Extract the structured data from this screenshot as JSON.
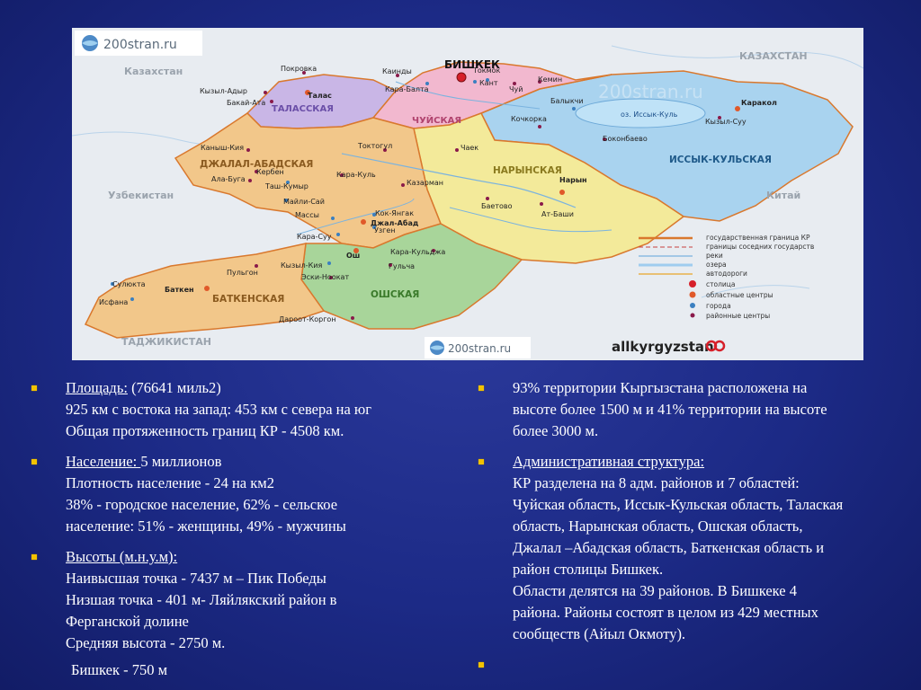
{
  "map": {
    "logo_top": "200stran.ru",
    "logo_bottom": "200stran.ru",
    "watermark": "200stran.ru",
    "brand_logo": "allkyrgyzstan",
    "countries": {
      "kazakhstan_left": "Казахстан",
      "kazakhstan_right": "КАЗАХСТАН",
      "uzbekistan": "Узбекистан",
      "china": "Китай",
      "tajikistan": "ТАДЖИКИСТАН"
    },
    "regions": {
      "talas": "ТАЛАССКАЯ",
      "chuy": "ЧУЙСКАЯ",
      "jalalabad": "ДЖАЛАЛ-АБАДСКАЯ",
      "naryn": "НАРЫНСКАЯ",
      "issykkul": "ИССЫК-КУЛЬСКАЯ",
      "osh": "ОШСКАЯ",
      "batken": "БАТКЕНСКАЯ"
    },
    "lake": "оз. Иссык-Куль",
    "capital": "БИШКЕК",
    "cities": [
      "Покровка",
      "Каинды",
      "Токмок",
      "Кызыл-Адыр",
      "Бакай-Ата",
      "Талас",
      "Кара-Балта",
      "Кант",
      "Чуй",
      "Кемин",
      "Балыкчи",
      "Каракол",
      "Кызыл-Суу",
      "Кочкорка",
      "Токтогул",
      "Чаек",
      "Боконбаево",
      "Каныш-Кия",
      "Кербен",
      "Ала-Буга",
      "Таш-Кумыр",
      "Кара-Куль",
      "Майли-Сай",
      "Казарман",
      "Нарын",
      "Массы",
      "Кок-Янгак",
      "Джал-Абад",
      "Баетово",
      "Ат-Баши",
      "Кара-Суу",
      "Узген",
      "Ош",
      "Кара-Кульджа",
      "Кызыл-Кия",
      "Гульча",
      "Сулюкта",
      "Пульгон",
      "Эски-Ноокат",
      "Баткен",
      "Исфана",
      "Дароот-Коргон"
    ],
    "legend": [
      "государственная граница КР",
      "границы соседних государств",
      "реки",
      "озера",
      "автодороги",
      "столица",
      "областные центры",
      "города",
      "районные центры"
    ],
    "colors": {
      "talas": "#c9b6e6",
      "chuy": "#f2b8cf",
      "jalalabad": "#f2c78a",
      "naryn": "#f3ea9a",
      "issykkul": "#a9d3ef",
      "osh": "#a8d59a",
      "batken": "#f2c78a",
      "lake": "#bfe2f7",
      "border": "#d9782d"
    }
  },
  "left_items": [
    {
      "title": "Площадь:",
      "rest": " (76641 миль2)",
      "lines": [
        "925 км с востока на запад: 453 км с севера на юг",
        "Общая протяженность границ КР  - 4508 км."
      ]
    },
    {
      "title": "Население: ",
      "rest": "5 миллионов",
      "lines": [
        "Плотность население - 24 на км2",
        "38% - городское население, 62% - сельское",
        "население: 51% - женщины, 49% - мужчины"
      ]
    },
    {
      "title": "Высоты (м.н.у.м):",
      "rest": "",
      "lines": [
        "Наивысшая точка - 7437 м – Пик Победы",
        "Низшая точка - 401 м- Ляйлякский район в",
        "Ферганской долине",
        "Средняя высота - 2750 м."
      ],
      "after": "Бишкек - 750 м"
    }
  ],
  "right_items": [
    {
      "lines": [
        "93% территории Кыргызстана расположена на",
        "высоте более 1500 м  и 41% территории на высоте",
        "более 3000 м."
      ]
    },
    {
      "title": "Административная структура:",
      "lines": [
        "КР  разделена на 8 адм. районов и 7 областей:",
        "Чуйская область, Иссык-Кульская область, Талаская",
        "область, Нарынская область, Ошская область,",
        "Джалал –Абадская область, Баткенская область и",
        "район столицы Бишкек.",
        "Области делятся на 39 районов. В Бишкеке 4",
        "района.  Районы состоят в целом из 429 местных",
        "сообществ (Айыл Окмоту)."
      ]
    }
  ]
}
